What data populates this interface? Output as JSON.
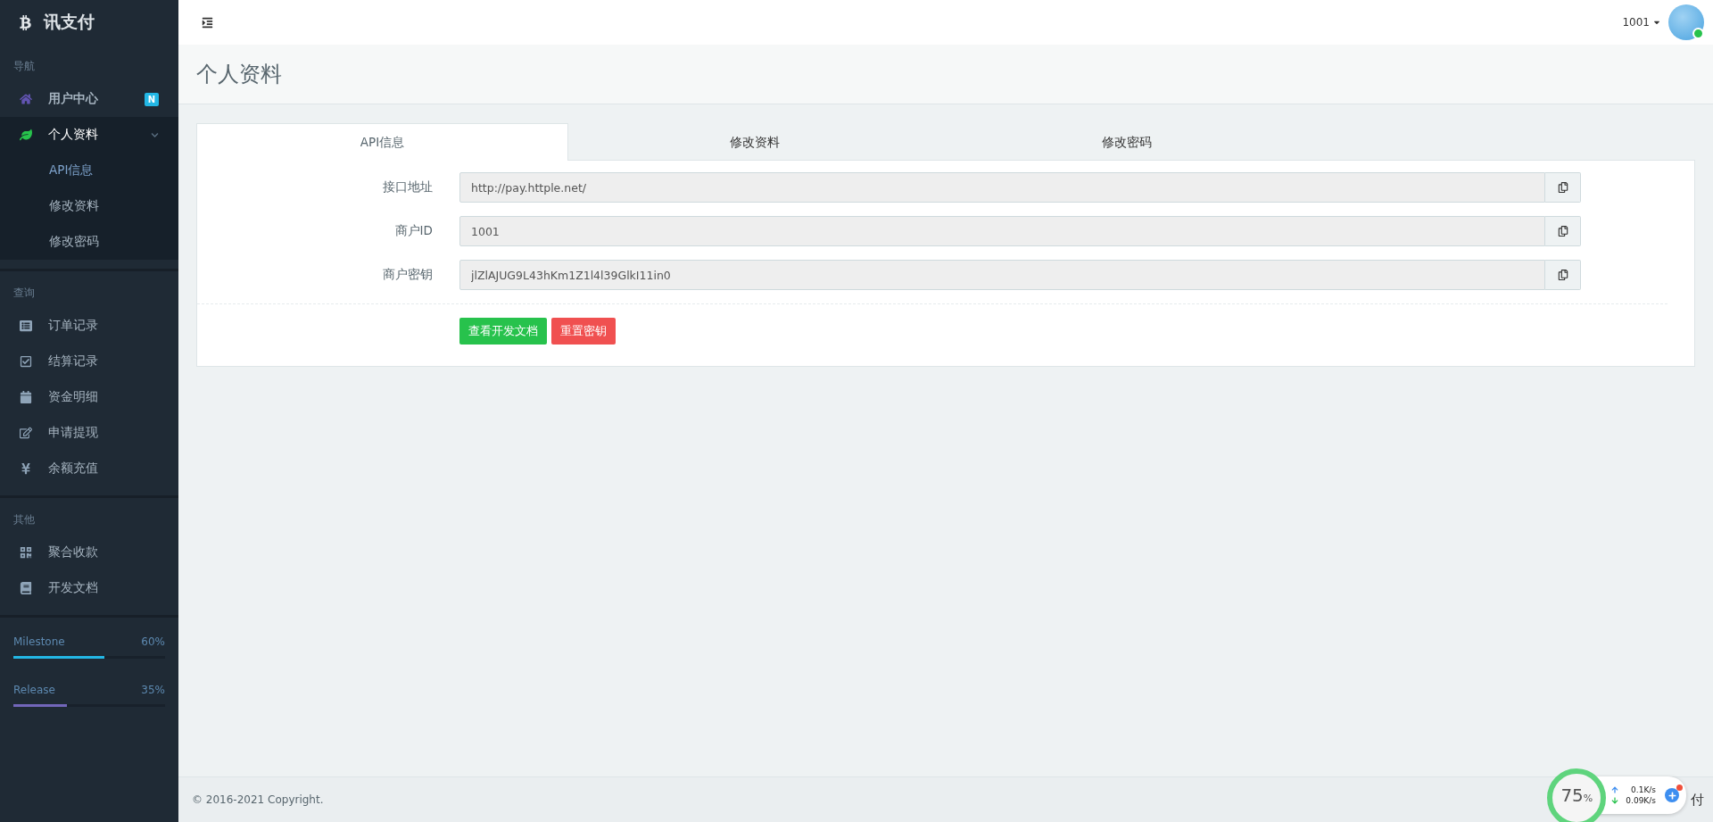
{
  "brand": {
    "name": "讯支付"
  },
  "sidebar": {
    "sections": [
      {
        "heading": "导航",
        "items": [
          {
            "label": "用户中心",
            "bold": true,
            "badge": "N",
            "selected": false
          },
          {
            "label": "个人资料",
            "bold": false,
            "selected": true,
            "expanded": true,
            "children": [
              {
                "label": "API信息",
                "selected": true
              },
              {
                "label": "修改资料",
                "selected": false
              },
              {
                "label": "修改密码",
                "selected": false
              }
            ]
          }
        ]
      },
      {
        "heading": "查询",
        "items": [
          {
            "label": "订单记录",
            "bold": false,
            "selected": false
          },
          {
            "label": "结算记录",
            "bold": false,
            "selected": false
          },
          {
            "label": "资金明细",
            "bold": false,
            "selected": false
          },
          {
            "label": "申请提现",
            "bold": false,
            "selected": false
          },
          {
            "label": "余额充值",
            "bold": false,
            "selected": false
          }
        ]
      },
      {
        "heading": "其他",
        "items": [
          {
            "label": "聚合收款",
            "bold": false,
            "selected": false
          },
          {
            "label": "开发文档",
            "bold": false,
            "selected": false
          }
        ]
      }
    ],
    "progress": [
      {
        "label": "Milestone",
        "reading": "60%",
        "level": 0.6,
        "color": "#23b7e5"
      },
      {
        "label": "Release",
        "reading": "35%",
        "level": 0.35,
        "color": "#7266ba"
      }
    ]
  },
  "header": {
    "user": "1001",
    "online": true
  },
  "page_title": "个人资料",
  "tabs": [
    {
      "label": "API信息",
      "selected": true
    },
    {
      "label": "修改资料",
      "selected": false
    },
    {
      "label": "修改密码",
      "selected": false
    }
  ],
  "fields": [
    {
      "label": "接口地址",
      "value": "http://pay.httple.net/"
    },
    {
      "label": "商户ID",
      "value": "1001"
    },
    {
      "label": "商户密钥",
      "value": "jlZlAJUG9L43hKm1Z1l4l39GlkI11in0"
    }
  ],
  "buttons": [
    {
      "label": "查看开发文档",
      "kind": "success"
    },
    {
      "label": "重置密钥",
      "kind": "danger"
    }
  ],
  "footer": {
    "copyright": "© 2016-2021 Copyright.",
    "right": "付"
  },
  "widget": {
    "percent": "75",
    "unit": "%",
    "up": "0.1K/s",
    "down": "0.09K/s"
  }
}
